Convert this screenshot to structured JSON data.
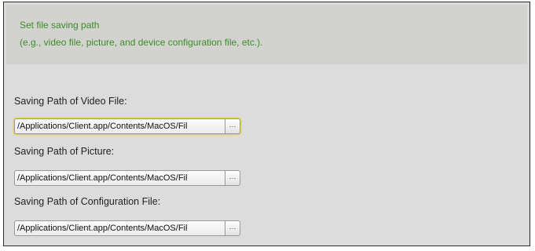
{
  "banner": {
    "line1": "Set file saving path",
    "line2": "(e.g., video file, picture, and device configuration file, etc.)."
  },
  "fields": {
    "video": {
      "label": "Saving Path of Video File:",
      "value": "/Applications/Client.app/Contents/MacOS/Fil",
      "browse_label": "···"
    },
    "picture": {
      "label": "Saving Path of Picture:",
      "value": "/Applications/Client.app/Contents/MacOS/Fil",
      "browse_label": "···"
    },
    "config": {
      "label": "Saving Path of Configuration File:",
      "value": "/Applications/Client.app/Contents/MacOS/Fil",
      "browse_label": "···"
    }
  },
  "colors": {
    "banner_text": "#3d8c2a",
    "focus_ring": "#e3d44a"
  }
}
